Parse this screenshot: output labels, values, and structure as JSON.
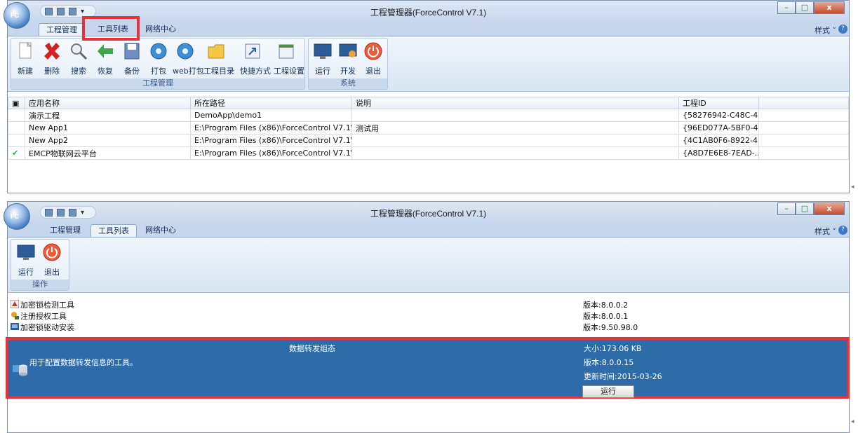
{
  "window": {
    "title": "工程管理器(ForceControl V7.1)"
  },
  "orb": {
    "label": "FC"
  },
  "title_controls": {
    "minimize": "–",
    "maximize": "□",
    "close": "x"
  },
  "tabs": [
    "工程管理",
    "工具列表",
    "网络中心"
  ],
  "style_menu": "样式 ˅",
  "panel1": {
    "ribbon_groups": [
      {
        "name": "工程管理",
        "buttons": [
          "新建",
          "删除",
          "搜索",
          "恢复",
          "备份",
          "打包",
          "web打包",
          "工程目录",
          "快捷方式",
          "工程设置"
        ]
      },
      {
        "name": "系统",
        "buttons": [
          "运行",
          "开发",
          "退出"
        ]
      }
    ],
    "columns": [
      "应用名称",
      "所在路径",
      "说明",
      "工程ID"
    ],
    "rows": [
      {
        "name": "演示工程",
        "path": "DemoApp\\demo1",
        "desc": "",
        "id": "{58276942-C48C-4...",
        "check": ""
      },
      {
        "name": "New App1",
        "path": "E:\\Program Files (x86)\\ForceControl V7.1\\...",
        "desc": "测试用",
        "id": "{96ED077A-5BF0-4...",
        "check": ""
      },
      {
        "name": "New App2",
        "path": "E:\\Program Files (x86)\\ForceControl V7.1\\...",
        "desc": "",
        "id": "{4C1AB0F6-8922-4...",
        "check": ""
      },
      {
        "name": "EMCP物联网云平台",
        "path": "E:\\Program Files (x86)\\ForceControl V7.1\\...",
        "desc": "",
        "id": "{A8D7E6E8-7EAD-...",
        "check": "✔"
      }
    ]
  },
  "panel2": {
    "ribbon_group": {
      "name": "操作",
      "buttons": [
        "运行",
        "退出"
      ]
    },
    "tools": [
      {
        "name": "加密锁检测工具",
        "version": "版本:8.0.0.2"
      },
      {
        "name": "注册授权工具",
        "version": "版本:8.0.0.1"
      },
      {
        "name": "加密锁驱动安装",
        "version": "版本:9.50.98.0"
      }
    ],
    "selected": {
      "title": "数据转发组态",
      "desc": "用于配置数据转发信息的工具。",
      "size": "大小:173.06 KB",
      "version": "版本:8.0.0.15",
      "updated": "更新时间:2015-03-26",
      "run": "运行"
    }
  },
  "colors": {
    "accent": "#2d6ca8",
    "highlight": "#e5333b",
    "ribbon": "#d9e5f3"
  }
}
